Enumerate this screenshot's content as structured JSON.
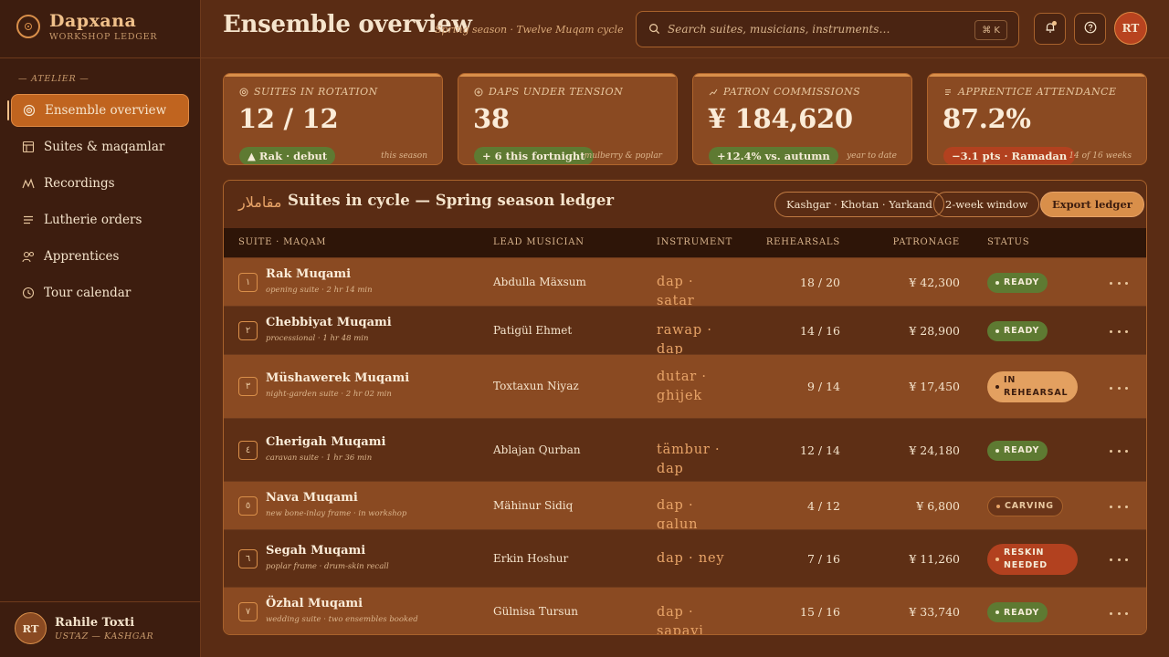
{
  "brand": {
    "name": "Dapxana",
    "subtitle": "WORKSHOP LEDGER"
  },
  "sidebar": {
    "section_label": "— ATELIER —",
    "items": [
      {
        "label": "Ensemble overview",
        "icon": "target-icon",
        "active": true
      },
      {
        "label": "Suites & maqamlar",
        "icon": "layout-icon"
      },
      {
        "label": "Recordings",
        "icon": "waveform-icon"
      },
      {
        "label": "Lutherie orders",
        "icon": "list-icon"
      },
      {
        "label": "Apprentices",
        "icon": "users-icon"
      },
      {
        "label": "Tour calendar",
        "icon": "clock-icon"
      }
    ],
    "user": {
      "initials": "RT",
      "name": "Rahile Toxti",
      "role": "USTAZ — KASHGAR"
    }
  },
  "header": {
    "title": "Ensemble overview",
    "subtitle": "Spring season · Twelve Muqam cycle",
    "search_placeholder": "Search suites, musicians, instruments…",
    "search_shortcut": "⌘ K",
    "avatar_initials": "RT"
  },
  "stats": [
    {
      "label": "SUITES IN ROTATION",
      "icon": "target-icon",
      "value": "12 / 12",
      "pill": "▲ Rak · debut",
      "pill_tone": "green",
      "note": "this season"
    },
    {
      "label": "DAPS UNDER TENSION",
      "icon": "plus-circle-icon",
      "value": "38",
      "pill": "+ 6 this fortnight",
      "pill_tone": "green",
      "note": "mulberry & poplar"
    },
    {
      "label": "PATRON COMMISSIONS",
      "icon": "trend-icon",
      "value": "¥ 184,620",
      "pill": "+12.4% vs. autumn",
      "pill_tone": "green",
      "note": "year to date"
    },
    {
      "label": "APPRENTICE ATTENDANCE",
      "icon": "list-icon",
      "value": "87.2%",
      "pill": "−3.1 pts · Ramadan",
      "pill_tone": "red",
      "note": "14 of 16 weeks"
    }
  ],
  "ledger": {
    "title_ar": "مقاملار",
    "title": "Suites in cycle — Spring season ledger",
    "chips": [
      "Kashgar · Khotan · Yarkand",
      "2-week window"
    ],
    "export_label": "Export ledger",
    "columns": [
      "SUITE · MAQAM",
      "LEAD MUSICIAN",
      "INSTRUMENT",
      "REHEARSALS",
      "PATRONAGE",
      "STATUS"
    ],
    "rows": [
      {
        "num": "١",
        "name": "Rak Muqami",
        "sub": "opening suite · 2 hr 14 min",
        "lead": "Abdulla Mäxsum",
        "instrument": "dap · satar",
        "rehearsals": "18 / 20",
        "patronage": "¥ 42,300",
        "status": "READY",
        "status_kind": "ready"
      },
      {
        "num": "٢",
        "name": "Chebbiyat Muqami",
        "sub": "processional · 1 hr 48 min",
        "lead": "Patigül Ehmet",
        "instrument": "rawap · dap",
        "rehearsals": "14 / 16",
        "patronage": "¥ 28,900",
        "status": "READY",
        "status_kind": "ready"
      },
      {
        "num": "٣",
        "name": "Müshawerek Muqami",
        "sub": "night-garden suite · 2 hr 02 min",
        "lead": "Toxtaxun Niyaz",
        "instrument": "dutar · ghijek",
        "rehearsals": "9 / 14",
        "patronage": "¥ 17,450",
        "status": "IN REHEARSAL",
        "status_kind": "rehearsal"
      },
      {
        "num": "٤",
        "name": "Cherigah Muqami",
        "sub": "caravan suite · 1 hr 36 min",
        "lead": "Ablajan Qurban",
        "instrument": "tämbur · dap",
        "rehearsals": "12 / 14",
        "patronage": "¥ 24,180",
        "status": "READY",
        "status_kind": "ready"
      },
      {
        "num": "٥",
        "name": "Nava Muqami",
        "sub": "new bone-inlay frame · in workshop",
        "lead": "Mähinur Sidiq",
        "instrument": "dap · qalun",
        "rehearsals": "4 / 12",
        "patronage": "¥ 6,800",
        "status": "CARVING",
        "status_kind": "carving"
      },
      {
        "num": "٦",
        "name": "Segah Muqami",
        "sub": "poplar frame · drum-skin recall",
        "lead": "Erkin Hoshur",
        "instrument": "dap · ney",
        "rehearsals": "7 / 16",
        "patronage": "¥ 11,260",
        "status": "RESKIN NEEDED",
        "status_kind": "reskin"
      },
      {
        "num": "٧",
        "name": "Özhal Muqami",
        "sub": "wedding suite · two ensembles booked",
        "lead": "Gülnisa Tursun",
        "instrument": "dap · sapayi",
        "rehearsals": "15 / 16",
        "patronage": "¥ 33,740",
        "status": "READY",
        "status_kind": "ready"
      }
    ]
  },
  "colors": {
    "accent": "#d98f4a",
    "active_nav": "#c0641f",
    "ready": "#5e7a32",
    "warning": "#b2411f"
  }
}
